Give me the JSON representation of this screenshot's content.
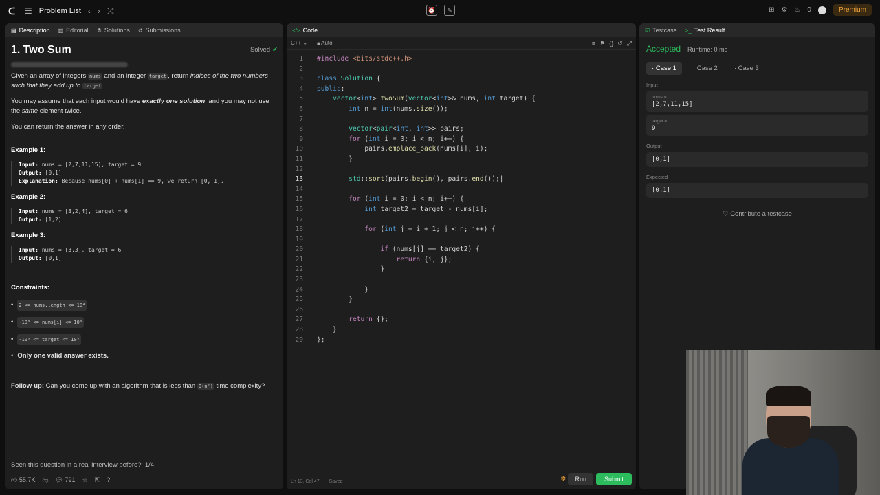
{
  "topbar": {
    "title": "Problem List",
    "fire_count": "0",
    "premium": "Premium"
  },
  "description": {
    "tabs": [
      "Description",
      "Editorial",
      "Solutions",
      "Submissions"
    ],
    "title": "1. Two Sum",
    "solved": "Solved",
    "p1a": "Given an array of integers ",
    "p1b": "nums",
    "p1c": " and an integer ",
    "p1d": "target",
    "p1e": ", return ",
    "p1f": "indices of the two numbers such that they add up to ",
    "p1g": "target",
    "p1h": ".",
    "p2a": "You may assume that each input would have ",
    "p2b": "exactly one solution",
    "p2c": ", and you may not use the ",
    "p2d": "same",
    "p2e": " element twice.",
    "p3": "You can return the answer in any order.",
    "examples": [
      {
        "title": "Example 1:",
        "input": "nums = [2,7,11,15], target = 9",
        "output": "[0,1]",
        "explanation": "Because nums[0] + nums[1] == 9, we return [0, 1]."
      },
      {
        "title": "Example 2:",
        "input": "nums = [3,2,4], target = 6",
        "output": "[1,2]"
      },
      {
        "title": "Example 3:",
        "input": "nums = [3,3], target = 6",
        "output": "[0,1]"
      }
    ],
    "constraints_title": "Constraints:",
    "constraints": [
      "2 <= nums.length <= 10⁴",
      "-10⁹ <= nums[i] <= 10⁹",
      "-10⁹ <= target <= 10⁹"
    ],
    "constraint_last": "Only one valid answer exists.",
    "followup_label": "Follow-up:",
    "followup_text": " Can you come up with an algorithm that is less than ",
    "followup_code": "O(n²)",
    "followup_end": " time complexity?",
    "seen": "Seen this question in a real interview before?",
    "seen_count": "1/4",
    "likes": "55.7K",
    "comments": "791"
  },
  "code": {
    "tab": "Code",
    "language": "C++",
    "mode": "Auto",
    "status_pos": "Ln 13, Col 47",
    "status_saved": "Saved",
    "run": "Run",
    "submit": "Submit",
    "current_line": 13
  },
  "result": {
    "tabs": [
      "Testcase",
      "Test Result"
    ],
    "status": "Accepted",
    "runtime": "Runtime: 0 ms",
    "cases": [
      "Case 1",
      "Case 2",
      "Case 3"
    ],
    "input_label": "Input",
    "nums_label": "nums =",
    "nums_value": "[2,7,11,15]",
    "target_label": "target =",
    "target_value": "9",
    "output_label": "Output",
    "output_value": "[0,1]",
    "expected_label": "Expected",
    "expected_value": "[0,1]",
    "contribute": "Contribute a testcase"
  },
  "colors": {
    "accent_green": "#2cbb5d",
    "premium": "#f0a43a"
  }
}
